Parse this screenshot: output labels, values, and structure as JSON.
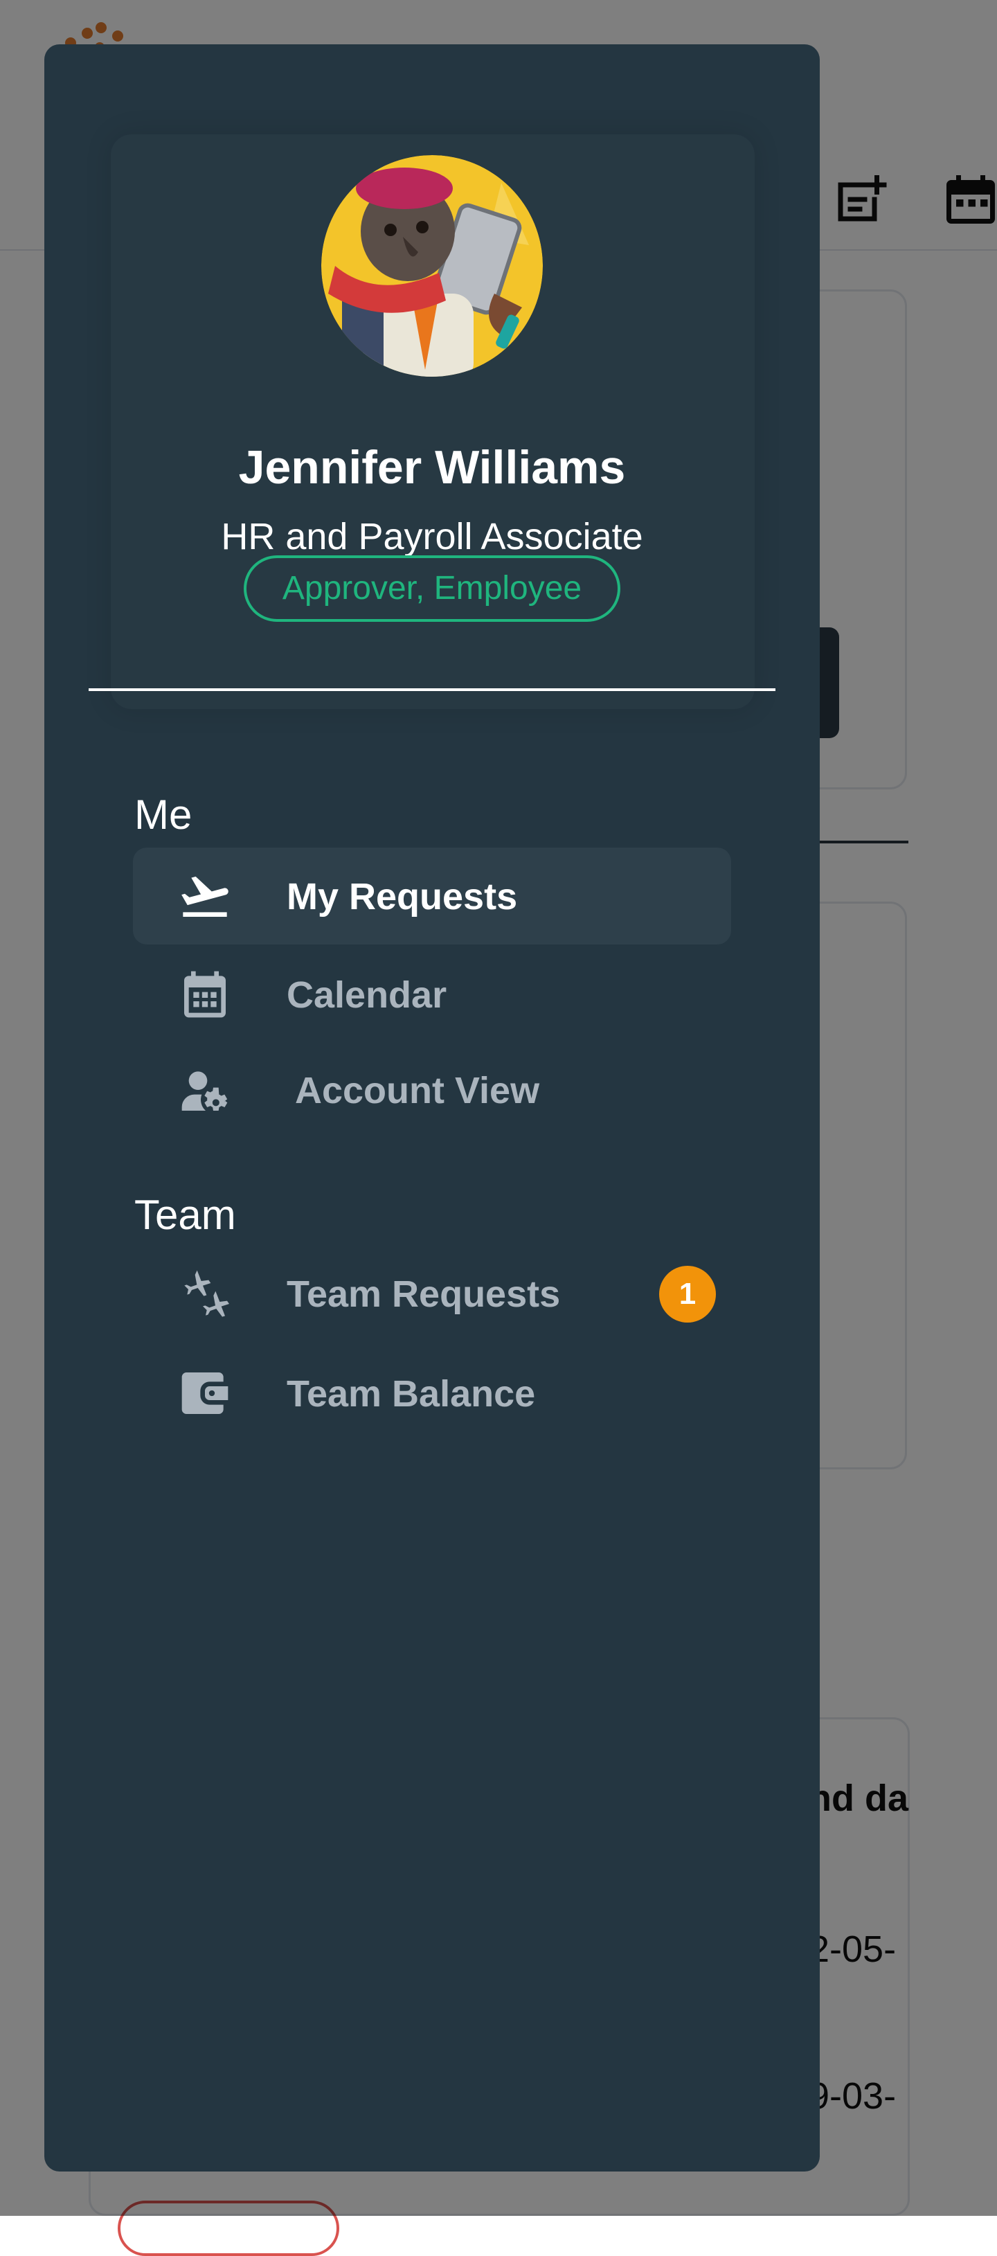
{
  "user": {
    "name": "Jennifer Williams",
    "job_title": "HR and Payroll Associate",
    "roles": "Approver, Employee"
  },
  "menu": {
    "sections": [
      {
        "label": "Me",
        "items": [
          {
            "label": "My Requests",
            "icon": "plane-departure-icon",
            "active": true
          },
          {
            "label": "Calendar",
            "icon": "calendar-icon"
          },
          {
            "label": "Account View",
            "icon": "user-gear-icon"
          }
        ]
      },
      {
        "label": "Team",
        "items": [
          {
            "label": "Team Requests",
            "icon": "planes-icon",
            "badge": "1"
          },
          {
            "label": "Team Balance",
            "icon": "wallet-icon"
          }
        ]
      }
    ]
  },
  "background": {
    "column_header": "nd da",
    "row_values": [
      "2-05-",
      "9-03-"
    ]
  },
  "colors": {
    "drawer_bg": "#243641",
    "active_item_bg": "#2e404b",
    "role_accent": "#1fb57e",
    "badge": "#f2930a",
    "inactive_text": "#aab4bd"
  }
}
